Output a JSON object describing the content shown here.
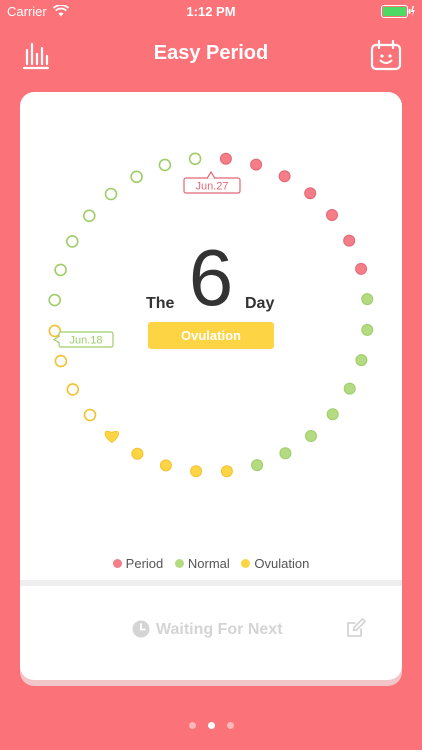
{
  "status": {
    "carrier": "Carrier",
    "time": "1:12 PM"
  },
  "header": {
    "title": "Easy Period",
    "stats_icon": "bar-chart-icon",
    "calendar_icon": "calendar-face-icon"
  },
  "cycle": {
    "prefix": "The",
    "day_number": "6",
    "suffix": "Day",
    "phase": "Ovulation",
    "period_label": "Jun.27",
    "ovulation_label": "Jun.18"
  },
  "legend": [
    {
      "label": "Period",
      "color": "#f47d88"
    },
    {
      "label": "Normal",
      "color": "#b5db82"
    },
    {
      "label": "Ovulation",
      "color": "#fdd444"
    }
  ],
  "footer": {
    "waiting_label": "Waiting For Next",
    "edit_icon": "edit-icon"
  },
  "pager": {
    "pages": 3,
    "current": 2
  },
  "colors": {
    "background": "#fb7279",
    "period": "#f47d88",
    "normal": "#b5db82",
    "ovulation": "#fdd444"
  }
}
